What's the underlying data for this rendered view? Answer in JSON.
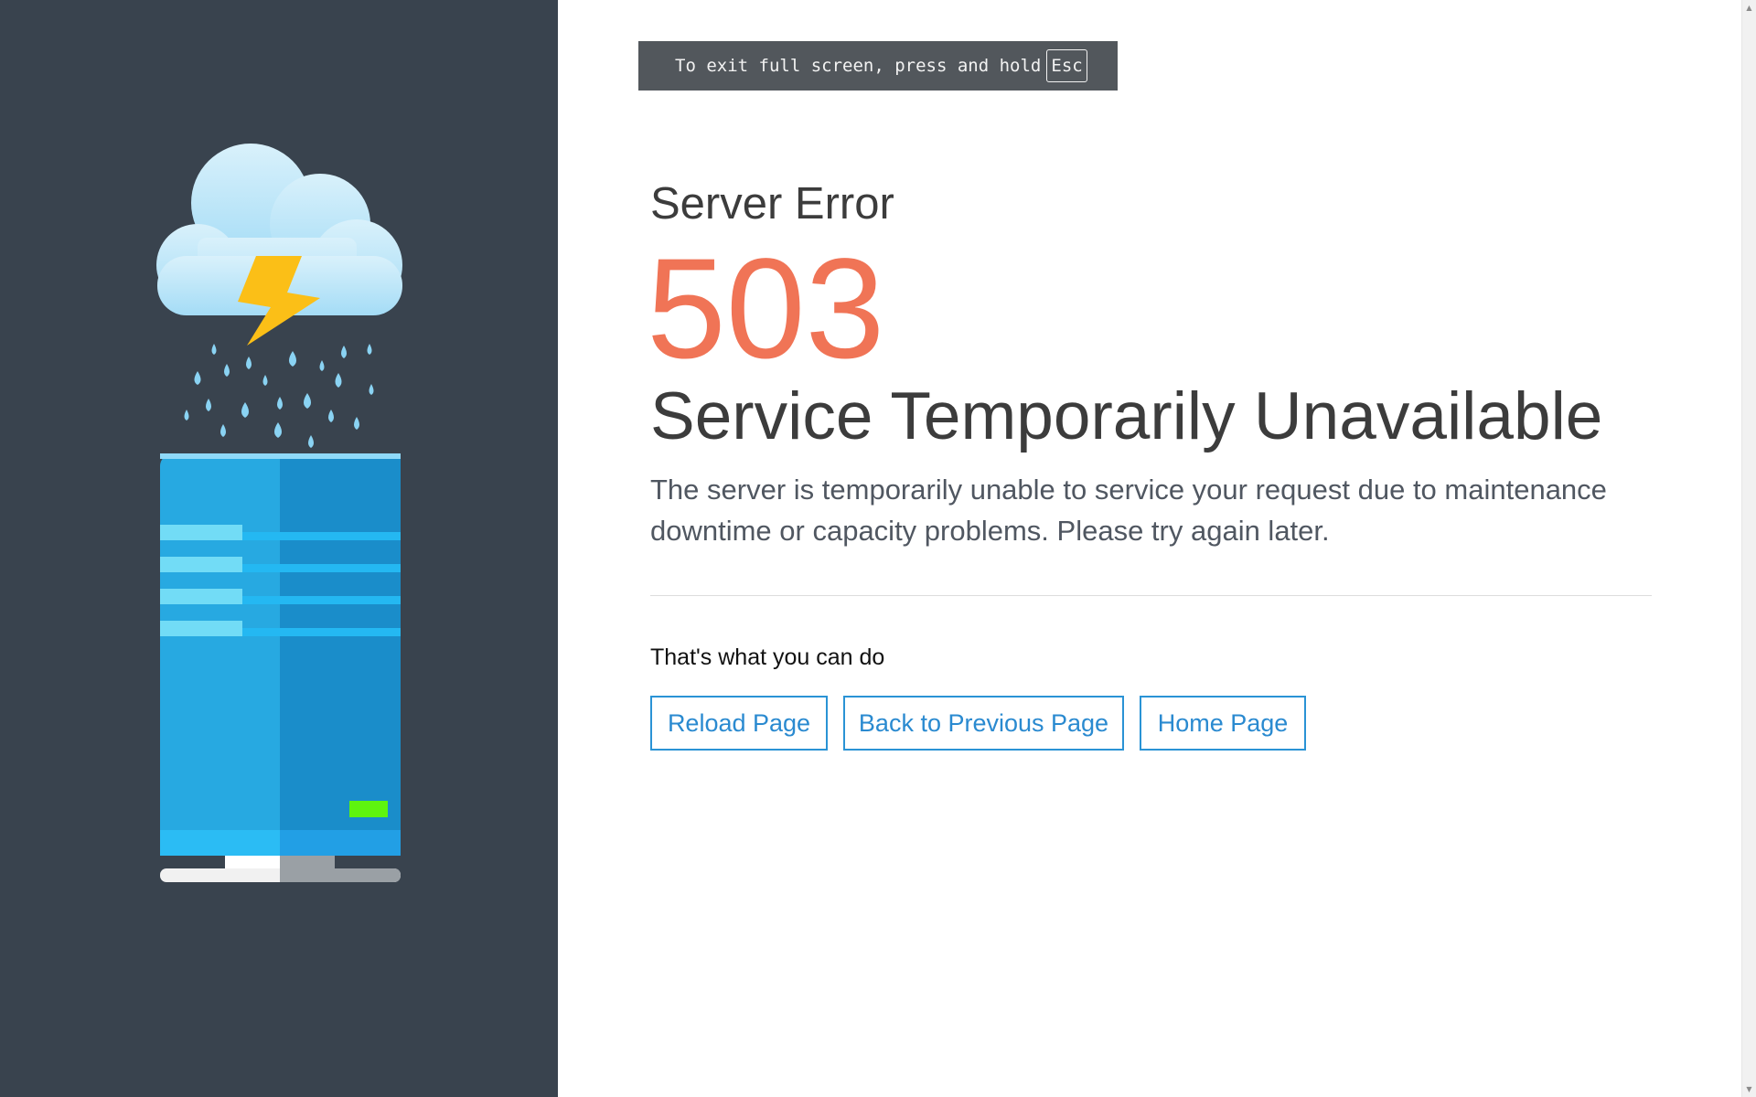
{
  "fullscreen_notice": {
    "text": "To exit full screen, press and hold",
    "key": "Esc"
  },
  "error": {
    "label": "Server Error",
    "code": "503",
    "title": "Service Temporarily Unavailable",
    "description": "The server is temporarily unable to service your request due to maintenance downtime or capacity problems. Please try again later."
  },
  "actions": {
    "heading": "That's what you can do",
    "buttons": {
      "reload": "Reload Page",
      "back": "Back to Previous Page",
      "home": "Home Page"
    }
  },
  "colors": {
    "left_panel": "#39434e",
    "error_code": "#f07456",
    "button_accent": "#2a93d5"
  },
  "illustration": {
    "icons": [
      "cloud-icon",
      "lightning-bolt-icon",
      "raindrops-icon",
      "server-icon"
    ]
  }
}
